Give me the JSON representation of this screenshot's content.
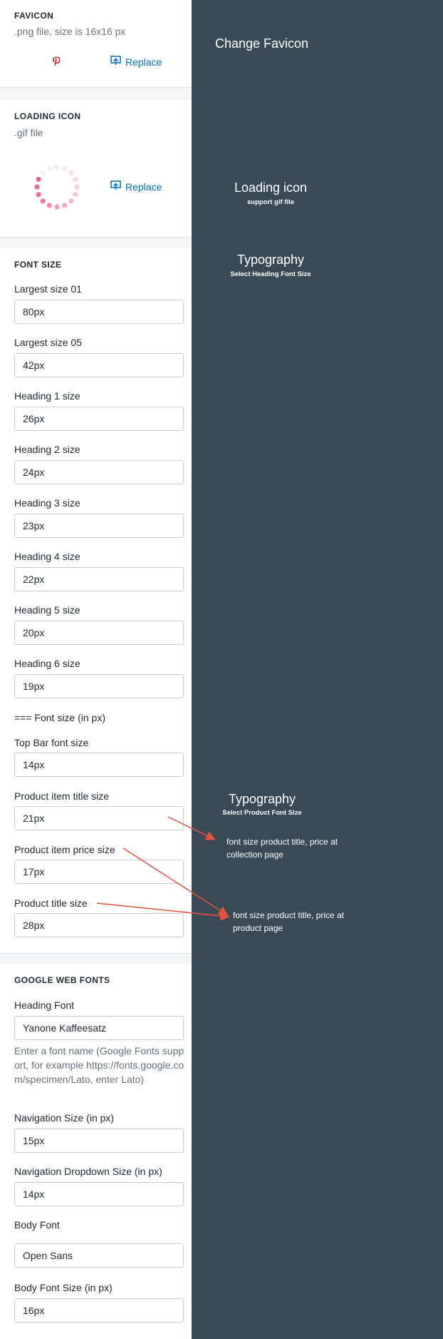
{
  "favicon": {
    "title": "FAVICON",
    "subtitle": ".png file, size is 16x16 px",
    "replace_label": "Replace"
  },
  "loading_icon": {
    "title": "LOADING ICON",
    "subtitle": ".gif file",
    "replace_label": "Replace"
  },
  "font_size": {
    "title": "FONT SIZE",
    "fields": [
      {
        "label": "Largest size 01",
        "value": "80px"
      },
      {
        "label": "Largest size 05",
        "value": "42px"
      },
      {
        "label": "Heading 1 size",
        "value": "26px"
      },
      {
        "label": "Heading 2 size",
        "value": "24px"
      },
      {
        "label": "Heading 3 size",
        "value": "23px"
      },
      {
        "label": "Heading 4 size",
        "value": "22px"
      },
      {
        "label": "Heading 5 size",
        "value": "20px"
      },
      {
        "label": "Heading 6 size",
        "value": "19px"
      }
    ],
    "separator": "=== Font size (in px)",
    "fields2": [
      {
        "label": "Top Bar font size",
        "value": "14px"
      },
      {
        "label": "Product item title size",
        "value": "21px"
      },
      {
        "label": "Product item price size",
        "value": "17px"
      },
      {
        "label": "Product title size",
        "value": "28px"
      }
    ]
  },
  "google_fonts": {
    "title": "GOOGLE WEB FONTS",
    "heading_font_label": "Heading Font",
    "heading_font_value": "Yanone Kaffeesatz",
    "help": "Enter a font name (Google Fonts support, for example https://fonts.google.com/specimen/Lato, enter Lato)",
    "nav_size_label": "Navigation Size (in px)",
    "nav_size_value": "15px",
    "nav_dropdown_label": "Navigation Dropdown Size (in px)",
    "nav_dropdown_value": "14px",
    "body_font_label": "Body Font",
    "body_font_value": "Open Sans",
    "body_size_label": "Body Font Size (in px)",
    "body_size_value": "16px"
  },
  "annotations": {
    "favicon": "Change Favicon",
    "loading_title": "Loading icon",
    "loading_sub": "support gif file",
    "typo1_title": "Typography",
    "typo1_sub": "Select Heading Font Size",
    "typo2_title": "Typography",
    "typo2_sub": "Select Product Font Size",
    "note_collection": "font size product title, price at collection page",
    "note_product": "font size product title, price at product page"
  },
  "colors": {
    "accent_link": "#006fbb",
    "annotation_bg": "#394a56",
    "arrow": "#e5533d",
    "pinterest": "#cb2027",
    "spinner": "#f06292"
  },
  "icons": [
    "pinterest-icon",
    "replace-icon",
    "loading-spinner-icon"
  ]
}
